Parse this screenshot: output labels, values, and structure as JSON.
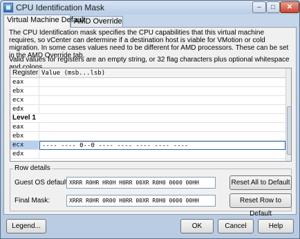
{
  "window": {
    "title": "CPU Identification Mask",
    "min_glyph": "–",
    "max_glyph": "□",
    "close_glyph": "✕"
  },
  "tabs": [
    {
      "label": "Virtual Machine Default",
      "active": true
    },
    {
      "label": "AMD Override",
      "active": false
    }
  ],
  "description": "The CPU Identification mask specifies the CPU capabilities that this virtual machine requires, so vCenter can determine if a destination host is viable for VMotion or cold migration. In some cases values need to be different for AMD processors. These can be set in the AMD Override tab.",
  "valid_values_text": "Valid values for registers are an empty string, or 32 flag characters plus optional whitespace and colons.",
  "table": {
    "headers": {
      "register": "Register",
      "value": "Value (msb...lsb)"
    },
    "rows": [
      {
        "register": "eax",
        "value": ""
      },
      {
        "register": "ebx",
        "value": ""
      },
      {
        "register": "ecx",
        "value": ""
      },
      {
        "register": "edx",
        "value": ""
      },
      {
        "register": "Level 1",
        "value": "",
        "is_level": true
      },
      {
        "register": "eax",
        "value": ""
      },
      {
        "register": "ebx",
        "value": ""
      },
      {
        "register": "ecx",
        "value": "---- ---- 0--0 ---- ---- ---- ---- ----",
        "selected": true
      },
      {
        "register": "edx",
        "value": ""
      }
    ]
  },
  "row_details": {
    "legend": "Row details",
    "guest_os_label": "Guest OS default:",
    "guest_os_value": "XRRR R0HR HR0H H0RR 00XR R0H0 0000 00HH",
    "final_mask_label": "Final Mask:",
    "final_mask_value": "XRRR R0HR 0R00 H0RR 00XR R0H0 0000 00HH",
    "reset_all_label": "Reset All to Default",
    "reset_row_label": "Reset Row to Default"
  },
  "footer": {
    "legend_label": "Legend...",
    "ok_label": "OK",
    "cancel_label": "Cancel",
    "help_label": "Help"
  }
}
